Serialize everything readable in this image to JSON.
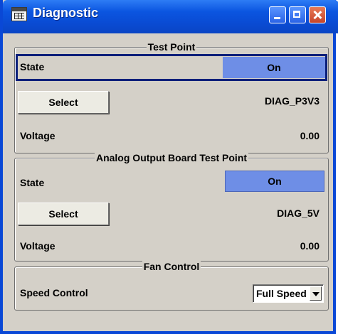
{
  "window": {
    "title": "Diagnostic",
    "accent_color": "#0a48d6",
    "title_icon": "dialog-grid-icon",
    "controls": [
      "minimize-icon",
      "maximize-icon",
      "close-icon"
    ]
  },
  "test_point": {
    "legend": "Test Point",
    "state_label": "State",
    "state_value": "On",
    "select_label": "Select",
    "selected_point": "DIAG_P3V3",
    "voltage_label": "Voltage",
    "voltage_value": "0.00"
  },
  "analog_test_point": {
    "legend": "Analog Output Board Test Point",
    "state_label": "State",
    "state_value": "On",
    "select_label": "Select",
    "selected_point": "DIAG_5V",
    "voltage_label": "Voltage",
    "voltage_value": "0.00"
  },
  "fan_control": {
    "legend": "Fan Control",
    "speed_label": "Speed Control",
    "speed_value": "Full Speed"
  },
  "colors": {
    "state_on": "#6e8ee6",
    "panel": "#d4d0c8"
  }
}
